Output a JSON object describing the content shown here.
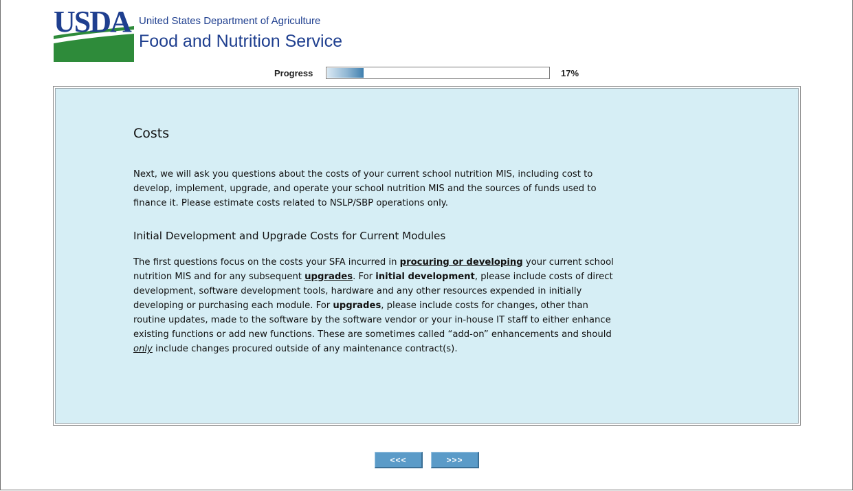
{
  "header": {
    "logo_text": "USDA",
    "department": "United States Department of Agriculture",
    "agency": "Food and Nutrition Service",
    "brand_blue": "#1f3f8f",
    "brand_green": "#2e8b3a"
  },
  "progress": {
    "label": "Progress",
    "percent": 17,
    "percent_text": "17%"
  },
  "content": {
    "title": "Costs",
    "intro": "Next, we will ask you questions about the costs of your current school nutrition MIS, including cost to develop, implement, upgrade, and operate your school nutrition MIS and the sources of funds used to finance it. Please estimate costs related to NSLP/SBP operations only.",
    "section_title": "Initial Development and Upgrade Costs for Current Modules",
    "body": {
      "part1": "The first questions focus on the costs your SFA incurred in ",
      "emph1": "procuring or developing",
      "part2": " your current school nutrition MIS and for any subsequent ",
      "emph2": "upgrades",
      "part3": ". For ",
      "emph3": "initial development",
      "part4": ", please include costs of direct development, software development tools, hardware and any other resources expended in initially developing or purchasing each module. For ",
      "emph4": "upgrades",
      "part5": ", please include costs for changes, other than routine updates, made to the software by the software vendor or your in-house IT staff to either enhance existing functions or add new functions. These are sometimes called “add-on” enhancements and should ",
      "emph5": "only",
      "part6": " include changes procured outside of any maintenance contract(s)."
    },
    "panel_bg": "#d6eef5"
  },
  "nav": {
    "back_label": "<<<",
    "next_label": ">>>",
    "button_color": "#5b9bc8"
  }
}
